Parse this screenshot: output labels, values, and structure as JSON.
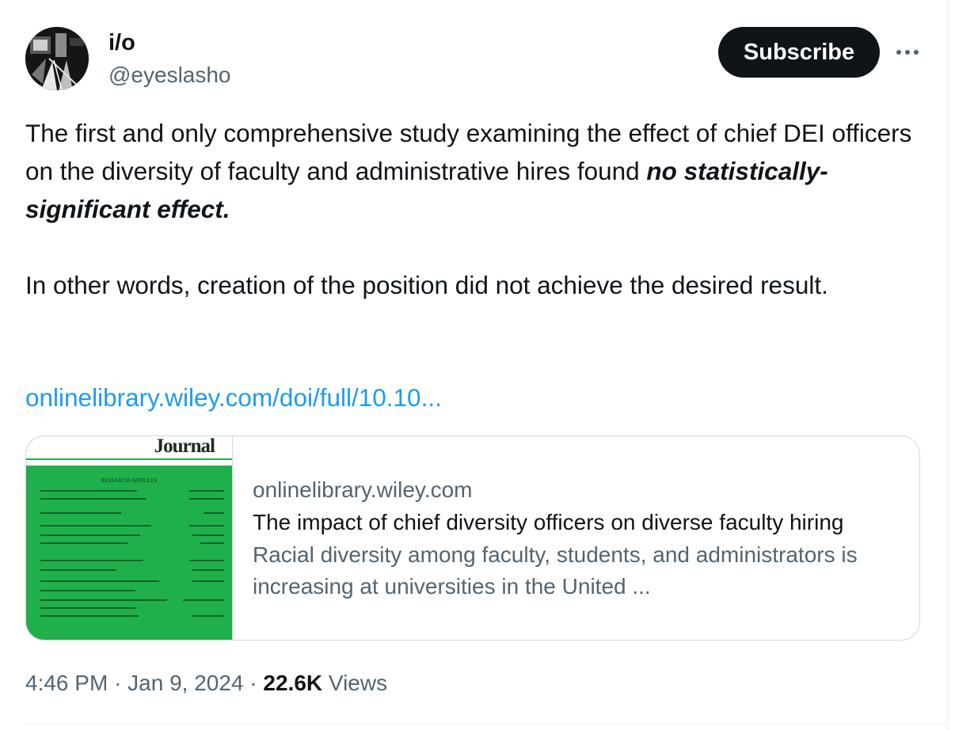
{
  "author": {
    "display_name": "i/o",
    "handle": "@eyeslasho",
    "avatar_icon": "avatar-image"
  },
  "header": {
    "subscribe_label": "Subscribe",
    "more_icon": "more-horizontal-icon"
  },
  "tweet": {
    "line1": "The first and only comprehensive study examining the effect of chief DEI officers on the diversity of faculty and administrative hires found ",
    "emphasis": "no statistically-significant effect.",
    "paragraph2": "In other words, creation of the position did not achieve the desired result.",
    "link": "onlinelibrary.wiley.com/doi/full/10.10..."
  },
  "card": {
    "thumbnail_title": "Journal",
    "thumbnail_heading": "RESEARCH ARTICLES",
    "domain": "onlinelibrary.wiley.com",
    "title": "The impact of chief diversity officers on diverse faculty hiring",
    "description": "Racial diversity among faculty, students, and administrators is increasing at universities in the United ..."
  },
  "meta": {
    "time": "4:46 PM",
    "separator": "·",
    "date": "Jan 9, 2024",
    "views_count": "22.6K",
    "views_label": "Views"
  },
  "colors": {
    "link": "#1d9bf0",
    "muted": "#536471",
    "text": "#0f1419",
    "thumbnail_green": "#1fb04b"
  }
}
